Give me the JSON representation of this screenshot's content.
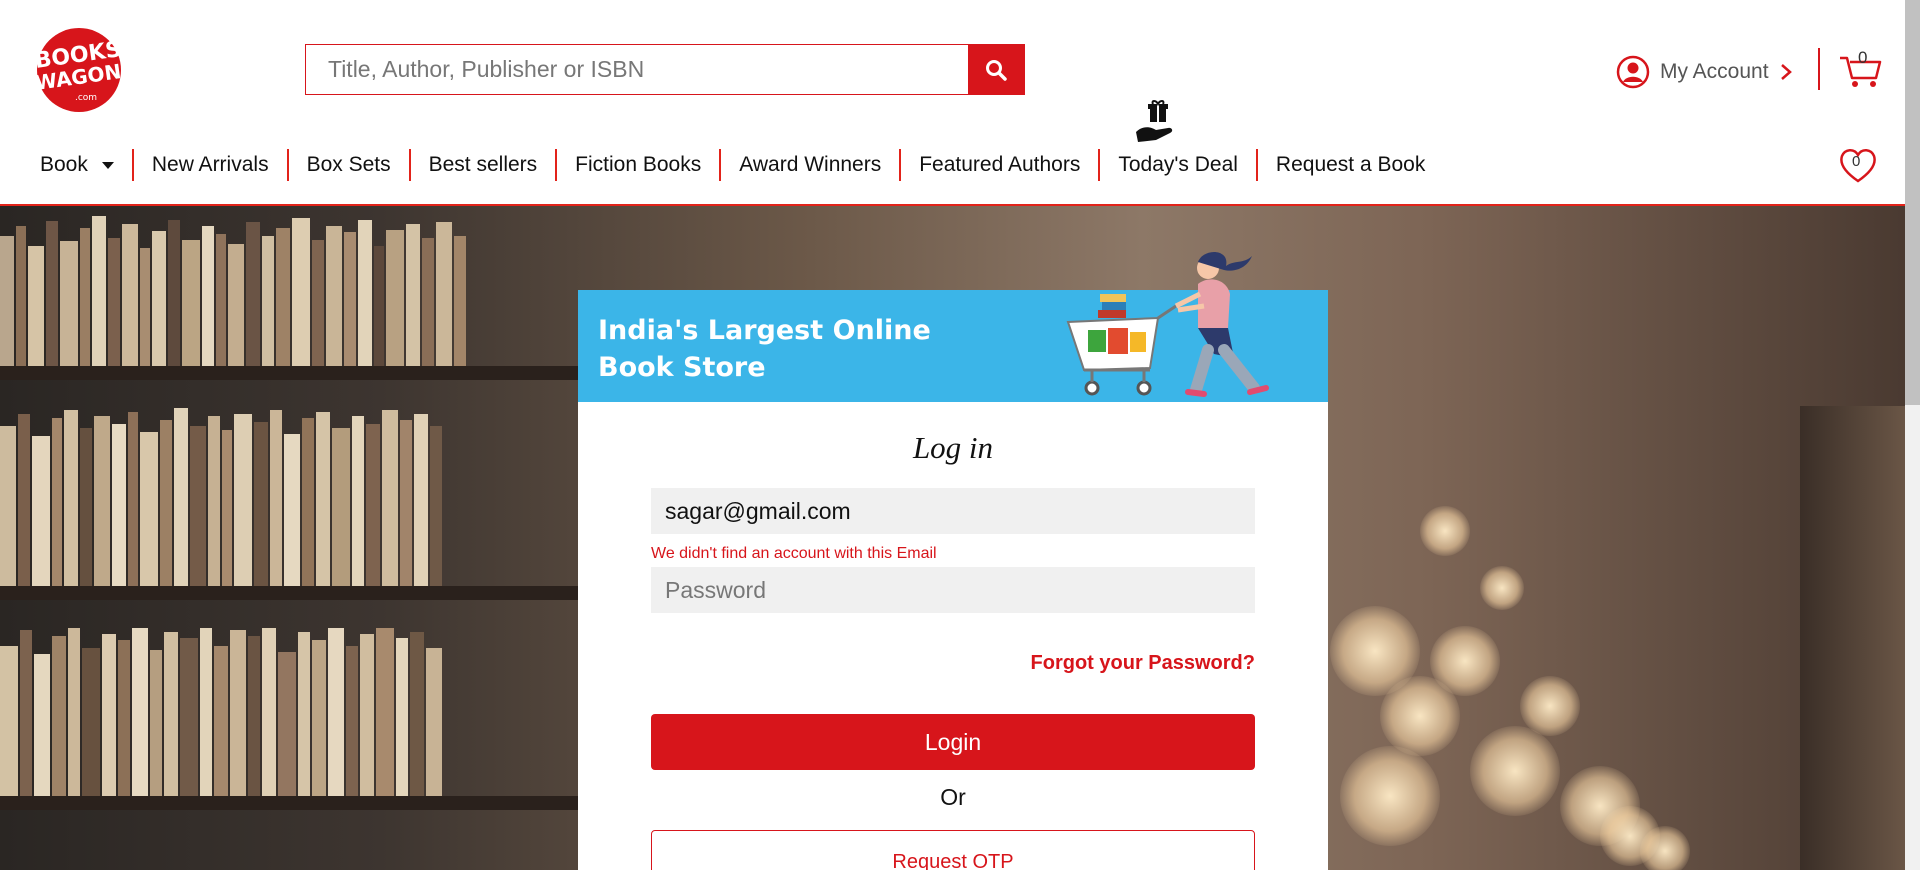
{
  "brand": {
    "logo_top": "BOOKS",
    "logo_bottom": "WAGON",
    "logo_domain": ".com",
    "color": "#d7151b"
  },
  "search": {
    "placeholder": "Title, Author, Publisher or ISBN",
    "icon": "search-icon"
  },
  "account": {
    "label": "My Account",
    "icon": "user-circle-icon"
  },
  "cart": {
    "count": "0",
    "icon": "cart-icon"
  },
  "wishlist": {
    "count": "0",
    "icon": "heart-icon"
  },
  "nav": {
    "items": [
      {
        "label": "Book"
      },
      {
        "label": "New Arrivals"
      },
      {
        "label": "Box Sets"
      },
      {
        "label": "Best sellers"
      },
      {
        "label": "Fiction Books"
      },
      {
        "label": "Award Winners"
      },
      {
        "label": "Featured Authors"
      },
      {
        "label": "Today's Deal"
      },
      {
        "label": "Request a Book"
      }
    ]
  },
  "banner": {
    "line1": "India's Largest Online",
    "line2": "Book Store",
    "bg_color": "#3bb5e8"
  },
  "login": {
    "title": "Log in",
    "email_value": "sagar@gmail.com",
    "email_error": "We didn't find an account with this Email",
    "password_placeholder": "Password",
    "forgot_label": "Forgot your Password?",
    "login_label": "Login",
    "or_label": "Or",
    "otp_label": "Request OTP"
  }
}
